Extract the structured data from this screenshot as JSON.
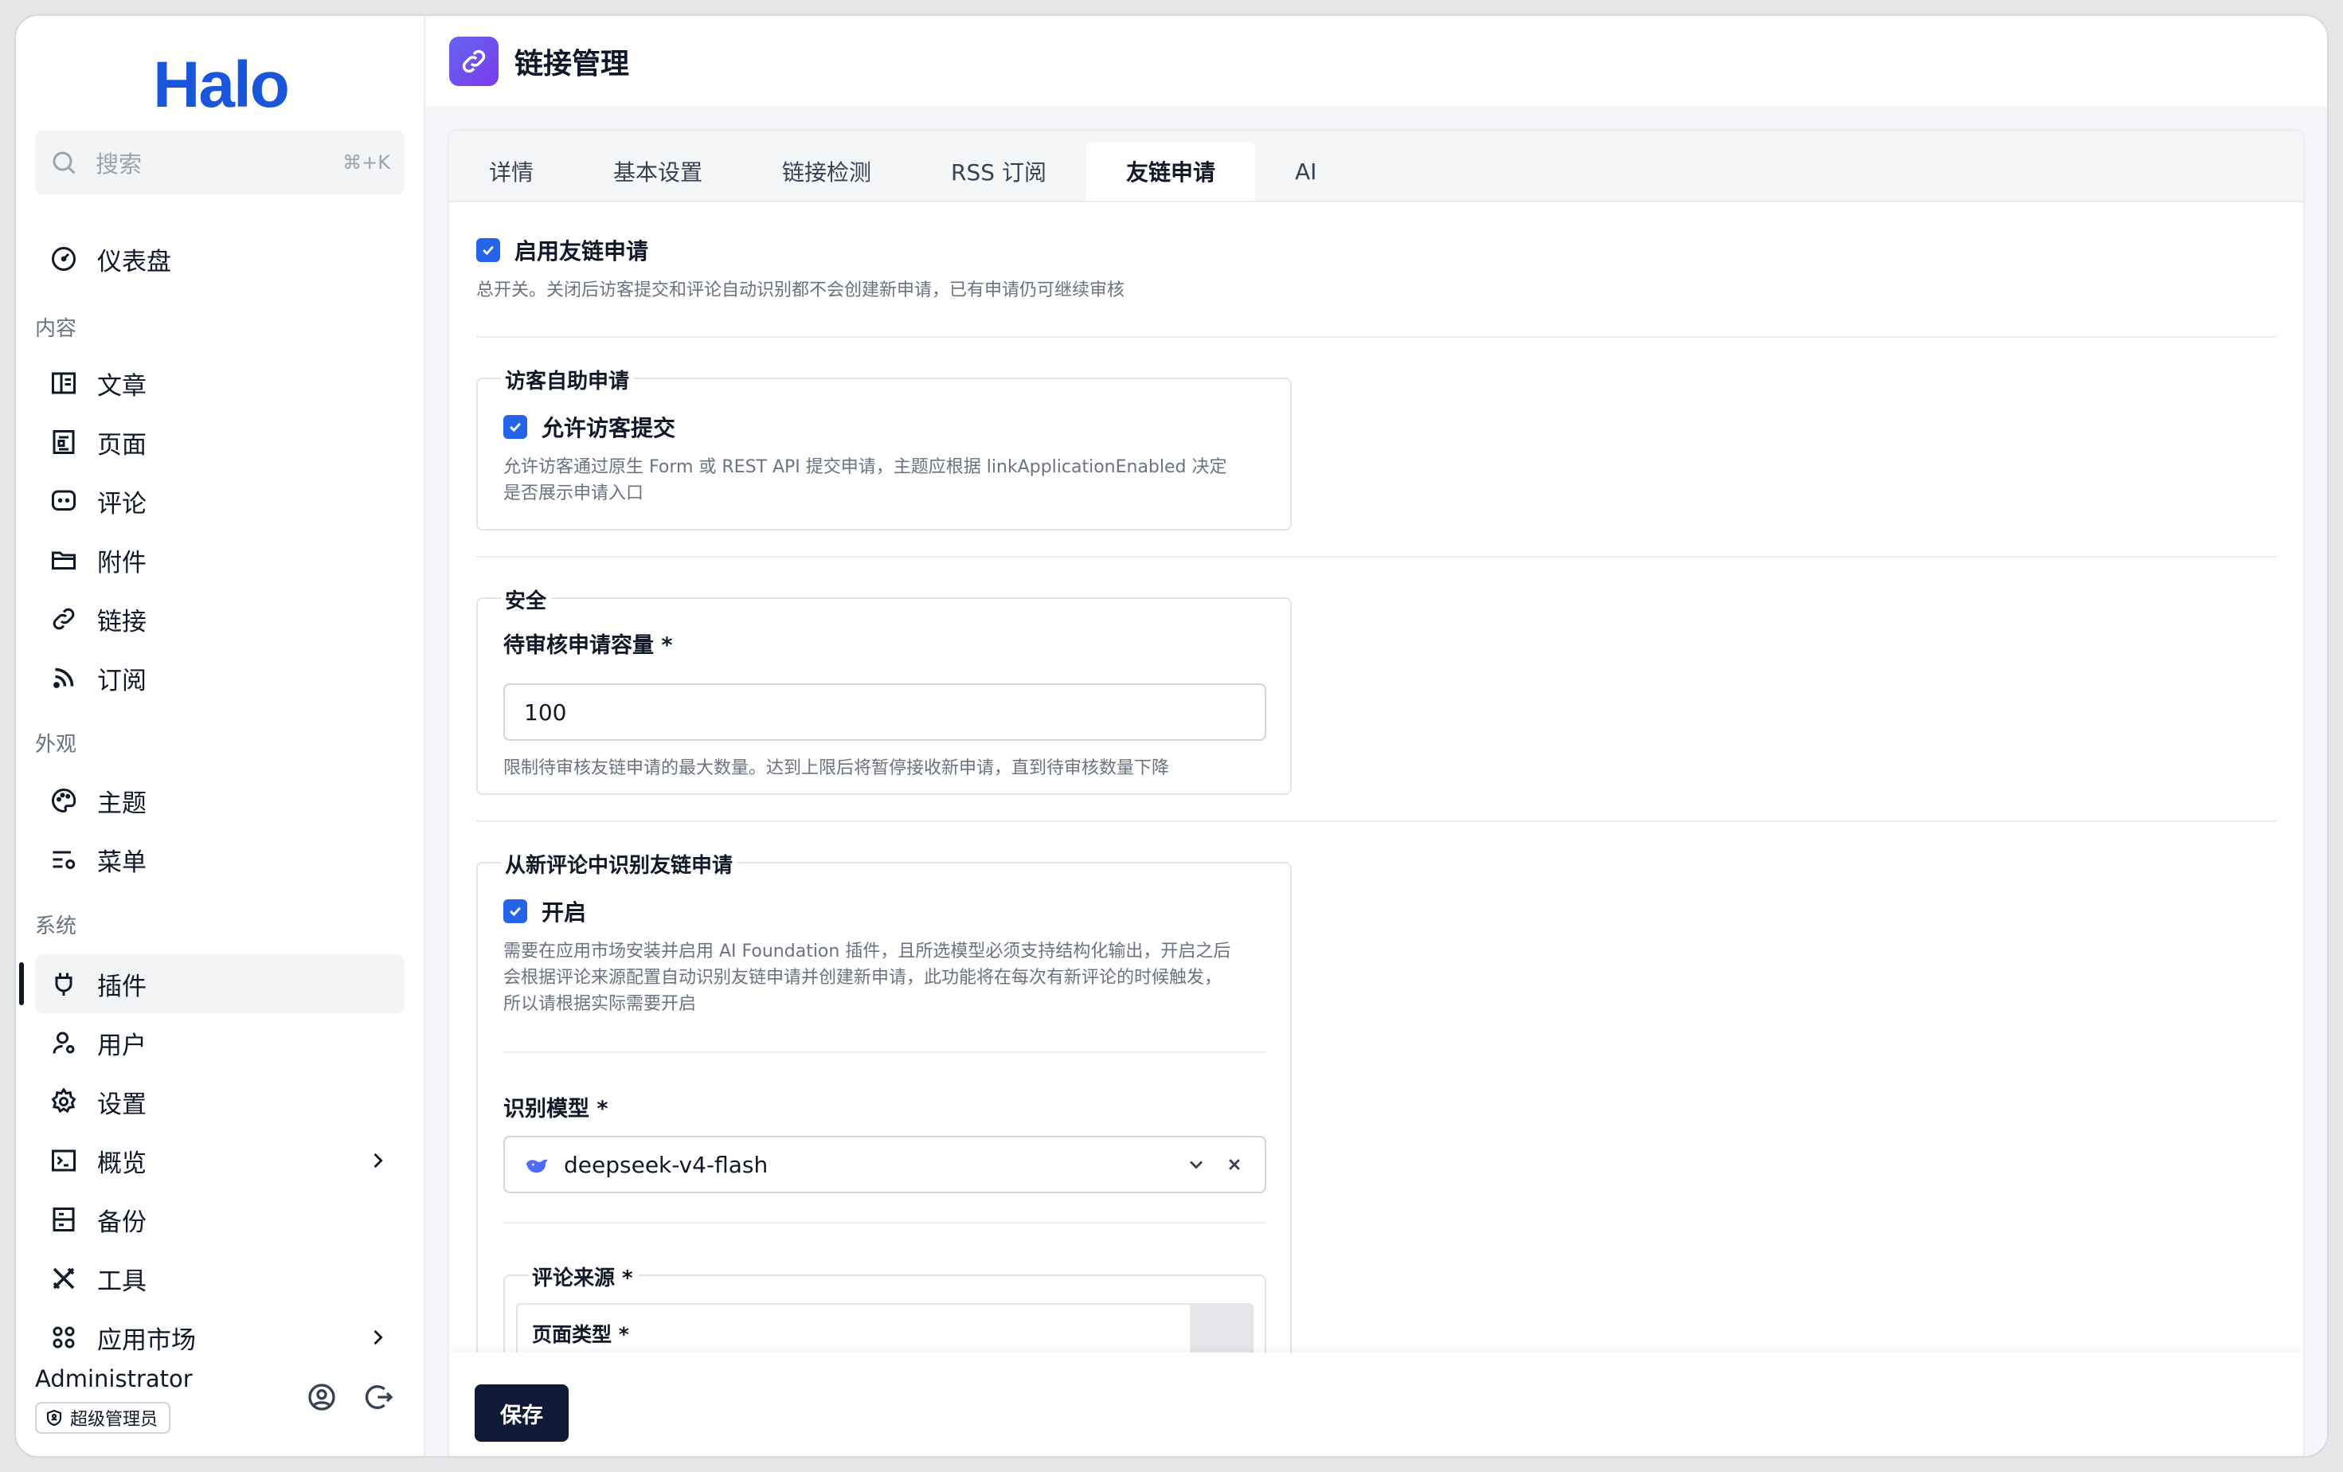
{
  "sidebar": {
    "logo": "Halo",
    "search": {
      "placeholder": "搜索",
      "shortcut": "⌘+K"
    },
    "dashboard": "仪表盘",
    "groups": {
      "content": "内容",
      "appearance": "外观",
      "system": "系统"
    },
    "items": {
      "posts": "文章",
      "pages": "页面",
      "comments": "评论",
      "attachments": "附件",
      "links": "链接",
      "subscriptions": "订阅",
      "themes": "主题",
      "menus": "菜单",
      "plugins": "插件",
      "users": "用户",
      "settings": "设置",
      "overview": "概览",
      "backup": "备份",
      "tools": "工具",
      "app_market": "应用市场"
    },
    "active_item": "插件",
    "user": {
      "name": "Administrator",
      "role": "超级管理员"
    }
  },
  "header": {
    "title": "链接管理",
    "icon": "link-icon"
  },
  "tabs": [
    {
      "label": "详情"
    },
    {
      "label": "基本设置"
    },
    {
      "label": "链接检测"
    },
    {
      "label": "RSS 订阅"
    },
    {
      "label": "友链申请",
      "active": true
    },
    {
      "label": "AI"
    }
  ],
  "form": {
    "enable": {
      "label": "启用友链申请",
      "checked": true,
      "help": "总开关。关闭后访客提交和评论自动识别都不会创建新申请，已有申请仍可继续审核"
    },
    "visitor": {
      "legend": "访客自助申请",
      "allow_label": "允许访客提交",
      "checked": true,
      "help_line1": "允许访客通过原生 Form 或 REST API 提交申请，主题应根据 linkApplicationEnabled 决定",
      "help_line2": "是否展示申请入口"
    },
    "security": {
      "legend": "安全",
      "capacity_label": "待审核申请容量 *",
      "capacity_value": "100",
      "help": "限制待审核友链申请的最大数量。达到上限后将暂停接收新申请，直到待审核数量下降"
    },
    "comment_detect": {
      "legend": "从新评论中识别友链申请",
      "enable_label": "开启",
      "checked": true,
      "help_line1": "需要在应用市场安装并启用 AI Foundation 插件，且所选模型必须支持结构化输出，开启之后",
      "help_line2": "会根据评论来源配置自动识别友链申请并创建新申请，此功能将在每次有新评论的时候触发，",
      "help_line3": "所以请根据实际需要开启",
      "model_label": "识别模型 *",
      "model_value": "deepseek-v4-flash",
      "source_legend": "评论来源 *",
      "page_type_label": "页面类型 *"
    }
  },
  "footer": {
    "save_label": "保存"
  },
  "colors": {
    "accent": "#2563eb",
    "brand": "#1a56db",
    "save_bg": "#0f1b36"
  }
}
